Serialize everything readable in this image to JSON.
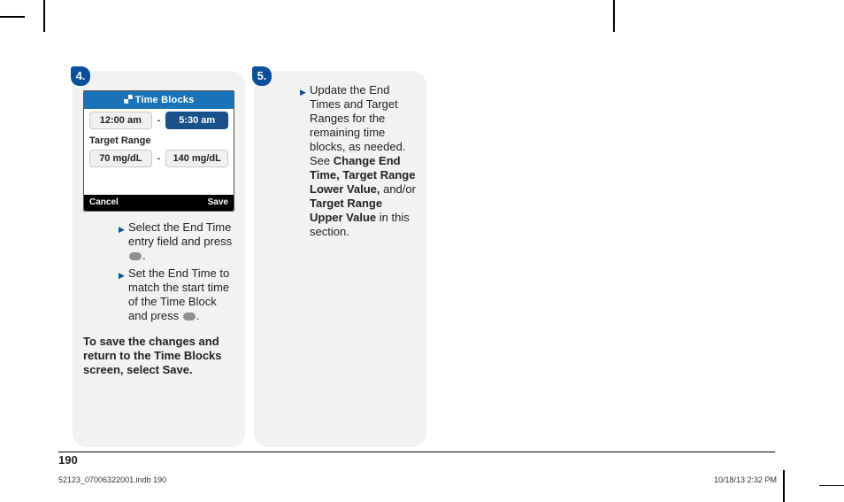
{
  "page_number": "190",
  "job": {
    "file": "52123_07006322001.indb   190",
    "stamp": "10/18/13   2:32 PM"
  },
  "card4": {
    "badge": "4.",
    "device": {
      "title": "Time Blocks",
      "start": "12:00 am",
      "end": "5:30 am",
      "range_label": "Target Range",
      "low": "70 mg/dL",
      "high": "140 mg/dL",
      "cancel": "Cancel",
      "save": "Save"
    },
    "b1": "Select the End Time entry field and press ",
    "b2": "Set the End Time to match the start time of the Time Block and press ",
    "note": "To save the changes and return to the Time Blocks screen, select Save."
  },
  "card5": {
    "badge": "5.",
    "t1": "Update the End Times and Target Ranges for the remaining time blocks, as needed. See ",
    "s1": "Change End Time, Target Range Lower Value,",
    "mid": " and/or ",
    "s2": "Target Range Upper Value",
    "t2": " in this section."
  }
}
